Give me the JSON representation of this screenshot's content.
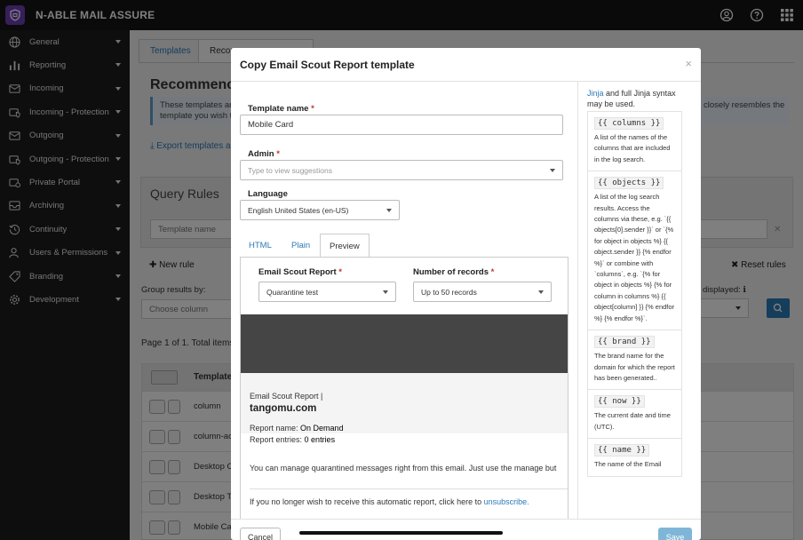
{
  "app": {
    "title": "N-ABLE MAIL ASSURE"
  },
  "sidebar": {
    "items": [
      {
        "label": "General",
        "icon": "globe-icon"
      },
      {
        "label": "Reporting",
        "icon": "bar-chart-icon"
      },
      {
        "label": "Incoming",
        "icon": "inbox-in-icon"
      },
      {
        "label": "Incoming - Protection",
        "icon": "shield-mail-icon"
      },
      {
        "label": "Outgoing",
        "icon": "outbox-icon"
      },
      {
        "label": "Outgoing - Protection",
        "icon": "shield-mail-icon"
      },
      {
        "label": "Private Portal",
        "icon": "portal-icon"
      },
      {
        "label": "Archiving",
        "icon": "archive-icon"
      },
      {
        "label": "Continuity",
        "icon": "history-icon"
      },
      {
        "label": "Users & Permissions",
        "icon": "users-icon"
      },
      {
        "label": "Branding",
        "icon": "tag-icon"
      },
      {
        "label": "Development",
        "icon": "gear-icon"
      }
    ]
  },
  "background": {
    "tabs": [
      "Templates",
      "Recom"
    ],
    "heading": "Recommenc",
    "info_line1": "These templates ar",
    "info_line2": "template you wish t",
    "info_right": "closely resembles the",
    "export": "Export templates a",
    "query_rules": "Query Rules",
    "template_name_placeholder": "Template name",
    "new_rule": "New rule",
    "reset_rules": "Reset rules",
    "group_results_by": "Group results by:",
    "choose_column": "Choose column",
    "displayed": "displayed:",
    "page_info": "Page 1 of 1. Total items",
    "table_header": "Template",
    "rows": [
      "column",
      "column-ac",
      "Desktop C",
      "Desktop T",
      "Mobile Ca"
    ]
  },
  "modal": {
    "title": "Copy Email Scout Report template",
    "close": "×",
    "template_name_label": "Template name",
    "template_name_value": "Mobile Card",
    "admin_label": "Admin",
    "admin_placeholder": "Type to view suggestions",
    "language_label": "Language",
    "language_value": "English United States (en-US)",
    "tabs": [
      "HTML",
      "Plain",
      "Preview"
    ],
    "active_tab": "Preview",
    "report_label": "Email Scout Report",
    "report_value": "Quarantine test",
    "records_label": "Number of records",
    "records_value": "Up to 50 records",
    "preview": {
      "title_line": "Email Scout Report |",
      "domain": "tangomu.com",
      "report_name_label": "Report name:",
      "report_name_value": "On Demand",
      "report_entries_label": "Report entries:",
      "report_entries_value": "0 entries",
      "manage_text": "You can manage quarantined messages right from this email. Just use the manage but",
      "unsubscribe_text": "If you no longer wish to receive this automatic report, click here to",
      "unsubscribe_link": "unsubscribe."
    },
    "help": {
      "intro_link": "Jinja",
      "intro_text": "and full Jinja syntax may be used.",
      "items": [
        {
          "code": "{{ columns }}",
          "desc": "A list of the names of the columns that are included in the log search."
        },
        {
          "code": "{{ objects }}",
          "desc": "A list of the log search results. Access the columns via these, e.g. `{{ objects[0].sender }}` or `{% for object in objects %} {{ object.sender }} {% endfor %}` or combine with `columns`, e.g. `{% for object in objects %} {% for column in columns %} {{ object[column] }} {% endfor %} {% endfor %}`."
        },
        {
          "code": "{{ brand }}",
          "desc": "The brand name for the domain for which the report has been generated.."
        },
        {
          "code": "{{ now }}",
          "desc": "The current date and time (UTC)."
        },
        {
          "code": "{{ name }}",
          "desc": "The name of the Email"
        }
      ]
    },
    "cancel": "Cancel",
    "save": "Save"
  }
}
